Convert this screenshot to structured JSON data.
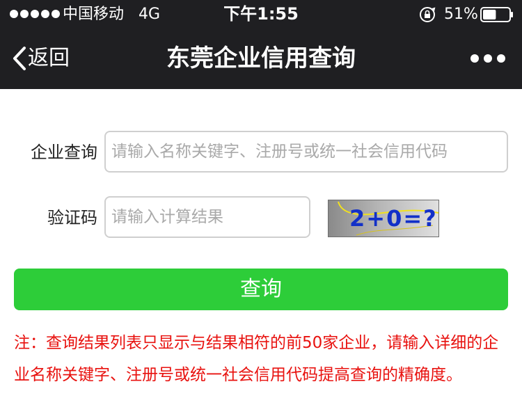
{
  "status_bar": {
    "carrier": "中国移动",
    "network": "4G",
    "time": "下午1:55",
    "battery_percent": "51%",
    "battery_level": 0.51,
    "lock_icon": "orientation-lock-icon"
  },
  "nav": {
    "back_label": "返回",
    "title": "东莞企业信用查询",
    "more_icon": "more-dots-icon"
  },
  "form": {
    "company_label": "企业查询",
    "company_placeholder": "请输入名称关键字、注册号或统一社会信用代码",
    "captcha_label": "验证码",
    "captcha_placeholder": "请输入计算结果",
    "captcha_text": "2+0=?",
    "search_button": "查询"
  },
  "notice": "注：查询结果列表只显示与结果相符的前50家企业，请输入详细的企业名称关键字、注册号或统一社会信用代码提高查询的精确度。",
  "colors": {
    "header_bg": "#1f1f22",
    "button_green": "#2dcd39",
    "notice_red": "#e8120f"
  }
}
